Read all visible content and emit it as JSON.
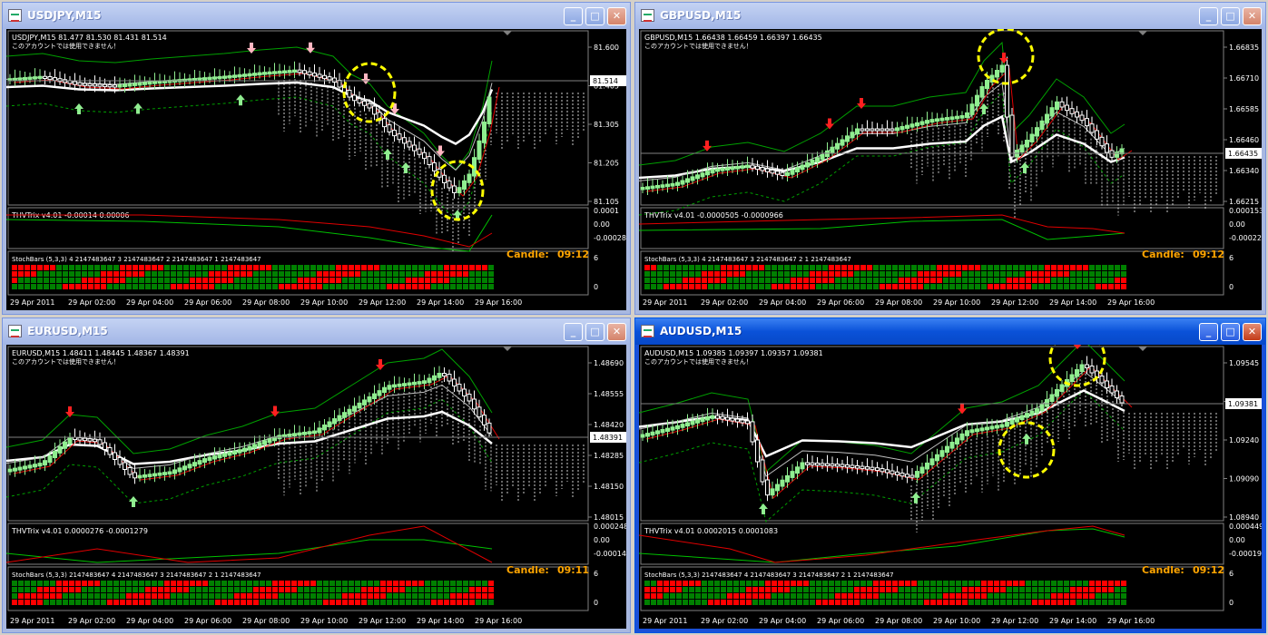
{
  "windows": [
    {
      "title": "USDJPY,M15",
      "active": false,
      "symbol_info": "USDJPY,M15  81.477 81.530 81.431 81.514",
      "account_note": "このアカウントでは使用できません！",
      "price_labels": [
        "81.600",
        "81.405",
        "81.305",
        "81.205",
        "81.105"
      ],
      "current_price": "81.514",
      "trix_label": "THVTrix v4.01 -0.00014 0.00006",
      "trix_scale": [
        "0.0001",
        "0.00",
        "-0.00028"
      ],
      "stoch_label": "StochBars (5,3,3) 4 2147483647 3 2147483647 2 2147483647 1 2147483647",
      "stoch_scale": [
        "6",
        "0"
      ],
      "candle_label": "Candle:",
      "candle_time": "09:12",
      "time_labels": [
        "29 Apr 2011",
        "29 Apr 02:00",
        "29 Apr 04:00",
        "29 Apr 06:00",
        "29 Apr 08:00",
        "29 Apr 10:00",
        "29 Apr 12:00",
        "29 Apr 14:00",
        "29 Apr 16:00"
      ]
    },
    {
      "title": "GBPUSD,M15",
      "active": false,
      "symbol_info": "GBPUSD,M15  1.66438 1.66459 1.66397 1.66435",
      "account_note": "このアカウントでは使用できません！",
      "price_labels": [
        "1.66835",
        "1.66710",
        "1.66585",
        "1.66460",
        "1.66340",
        "1.66215"
      ],
      "current_price": "1.66435",
      "trix_label": "THVTrix v4.01 -0.0000505 -0.0000966",
      "trix_scale": [
        "0.000153",
        "0.00",
        "-0.00022"
      ],
      "stoch_label": "StochBars (5,3,3) 4 2147483647 3 2147483647 2 1 2147483647",
      "stoch_scale": [
        "6",
        "0"
      ],
      "candle_label": "Candle:",
      "candle_time": "09:12",
      "time_labels": [
        "29 Apr 2011",
        "29 Apr 02:00",
        "29 Apr 04:00",
        "29 Apr 06:00",
        "29 Apr 08:00",
        "29 Apr 10:00",
        "29 Apr 12:00",
        "29 Apr 14:00",
        "29 Apr 16:00"
      ]
    },
    {
      "title": "EURUSD,M15",
      "active": false,
      "symbol_info": "EURUSD,M15  1.48411 1.48445 1.48367 1.48391",
      "account_note": "このアカウントでは使用できません！",
      "price_labels": [
        "1.48690",
        "1.48555",
        "1.48420",
        "1.48285",
        "1.48150",
        "1.48015"
      ],
      "current_price": "1.48391",
      "trix_label": "THVTrix v4.01 0.0000276 -0.0001279",
      "trix_scale": [
        "0.000248",
        "0.00",
        "-0.00014"
      ],
      "stoch_label": "StochBars (5,3,3) 2147483647 4 2147483647 3 2147483647 2 1 2147483647",
      "stoch_scale": [
        "6",
        "0"
      ],
      "candle_label": "Candle:",
      "candle_time": "09:11",
      "time_labels": [
        "29 Apr 2011",
        "29 Apr 02:00",
        "29 Apr 04:00",
        "29 Apr 06:00",
        "29 Apr 08:00",
        "29 Apr 10:00",
        "29 Apr 12:00",
        "29 Apr 14:00",
        "29 Apr 16:00"
      ]
    },
    {
      "title": "AUDUSD,M15",
      "active": true,
      "symbol_info": "AUDUSD,M15  1.09385 1.09397 1.09357 1.09381",
      "account_note": "このアカウントでは使用できません！",
      "price_labels": [
        "1.09545",
        "1.09381",
        "1.09240",
        "1.09090",
        "1.08940"
      ],
      "current_price": "1.09381",
      "trix_label": "THVTrix v4.01 0.0002015 0.0001083",
      "trix_scale": [
        "0.000449",
        "0.00",
        "-0.00019"
      ],
      "stoch_label": "StochBars (5,3,3) 2147483647 4 2147483647 3 2147483647 2 1 2147483647",
      "stoch_scale": [
        "6",
        "0"
      ],
      "candle_label": "Candle:",
      "candle_time": "09:12",
      "time_labels": [
        "29 Apr 2011",
        "29 Apr 02:00",
        "29 Apr 04:00",
        "29 Apr 06:00",
        "29 Apr 08:00",
        "29 Apr 10:00",
        "29 Apr 12:00",
        "29 Apr 14:00",
        "29 Apr 16:00"
      ]
    }
  ],
  "colors": {
    "bull_candle": "#90ee90",
    "bear_candle": "#ffffff",
    "trix_fast": "#00c000",
    "trix_slow": "#e00000",
    "stoch_red": "#ff0000",
    "stoch_green": "#008000",
    "candle_text": "#ffa500",
    "highlight": "#ffff00"
  },
  "icons": [
    "window-app-icon",
    "minimize-icon",
    "maximize-icon",
    "close-icon",
    "buy-arrow-icon",
    "sell-arrow-icon"
  ]
}
